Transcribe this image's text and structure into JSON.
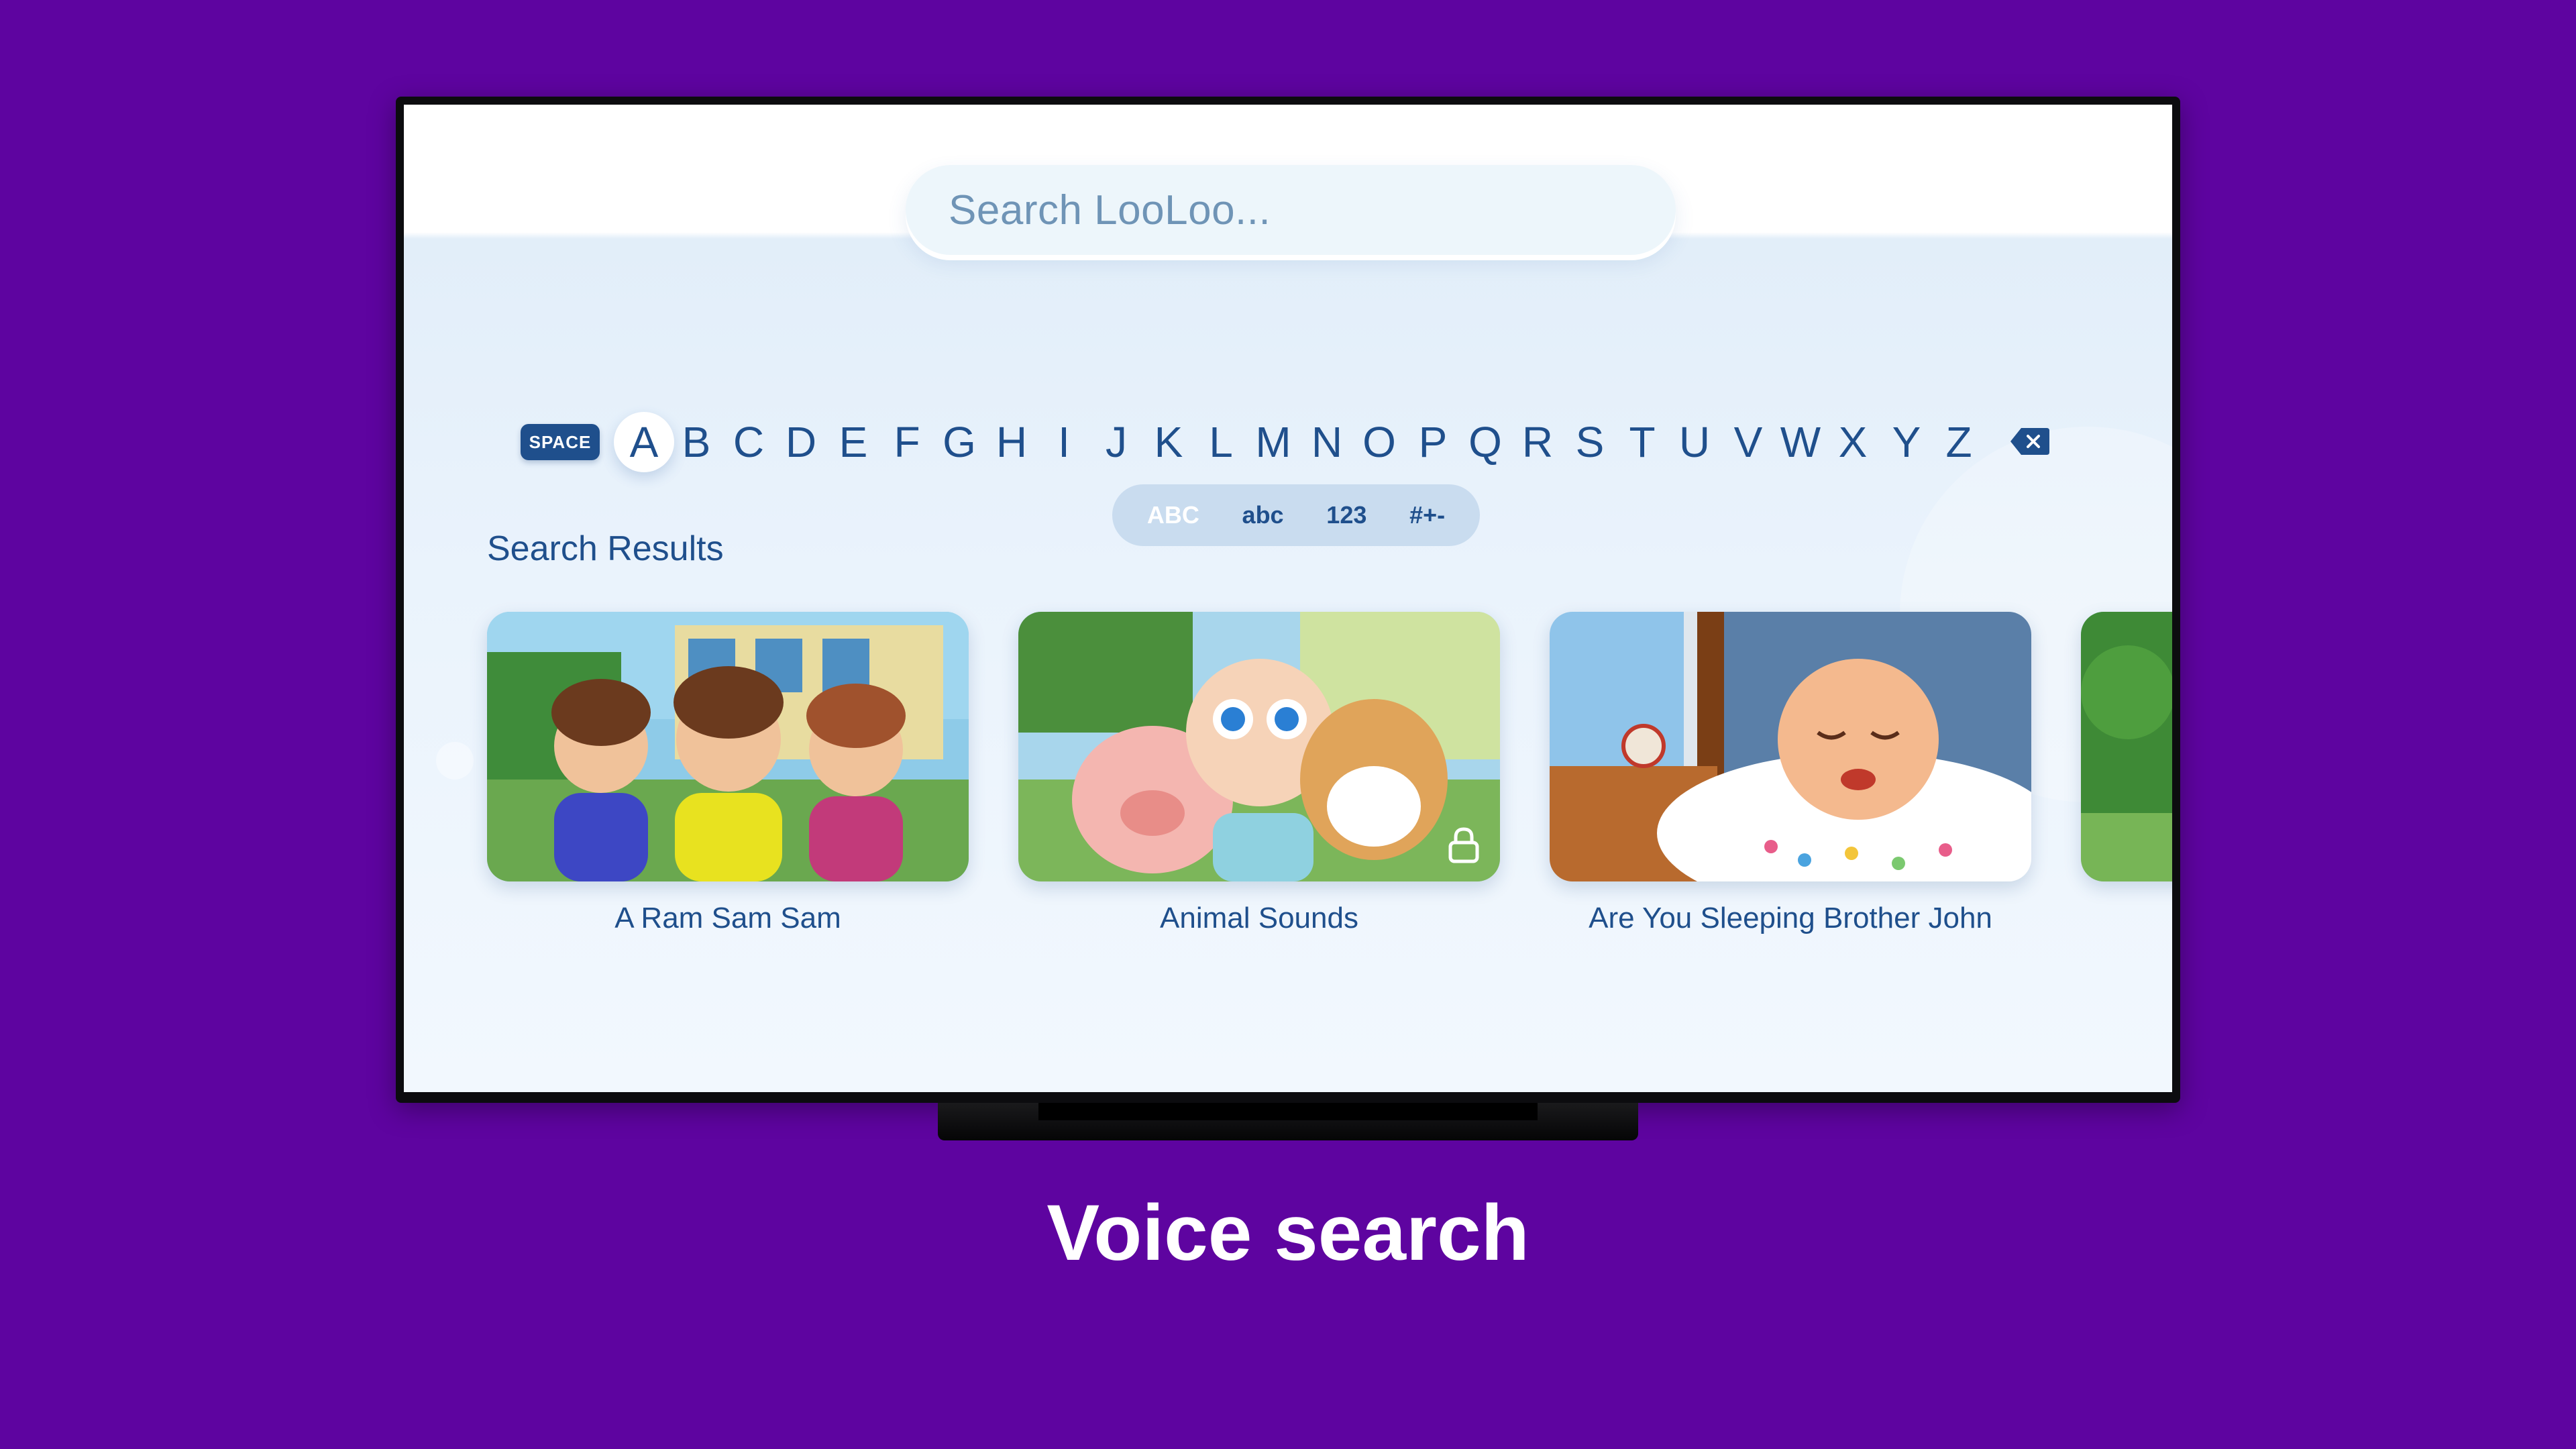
{
  "search": {
    "placeholder": "Search LooLoo..."
  },
  "keyboard": {
    "space_label": "SPACE",
    "letters": [
      "A",
      "B",
      "C",
      "D",
      "E",
      "F",
      "G",
      "H",
      "I",
      "J",
      "K",
      "L",
      "M",
      "N",
      "O",
      "P",
      "Q",
      "R",
      "S",
      "T",
      "U",
      "V",
      "W",
      "X",
      "Y",
      "Z"
    ],
    "selected_letter": "A",
    "backspace_icon": "backspace-icon",
    "modes": [
      "ABC",
      "abc",
      "123",
      "#+-"
    ],
    "active_mode": "ABC"
  },
  "results": {
    "title": "Search Results",
    "items": [
      {
        "title": "A Ram Sam Sam",
        "locked": false
      },
      {
        "title": "Animal Sounds",
        "locked": true
      },
      {
        "title": "Are You Sleeping Brother John",
        "locked": false
      },
      {
        "title": "",
        "locked": false
      }
    ]
  },
  "caption": "Voice search",
  "colors": {
    "background": "#5e04a0",
    "accent": "#1f4f8c",
    "screen": "#eaf3fc",
    "mode_active": "#ffffff"
  }
}
